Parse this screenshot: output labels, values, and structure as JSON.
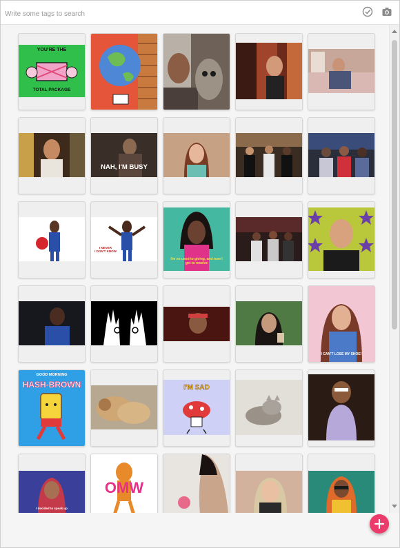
{
  "search": {
    "placeholder": "Write some tags to search",
    "value": ""
  },
  "toolbar": {
    "select_icon": "check-circle-icon",
    "capture_icon": "camera-icon"
  },
  "fab": {
    "icon": "plus-icon",
    "color": "#ec3b6b"
  },
  "gifs": {
    "r1": [
      {
        "text_top": "YOU'RE THE",
        "text_bottom": "TOTAL PACKAGE"
      },
      {
        "text": ""
      },
      {
        "text": ""
      },
      {
        "text": ""
      },
      {
        "text": ""
      }
    ],
    "r2": [
      {
        "text": ""
      },
      {
        "text": "NAH, I'M BUSY"
      },
      {
        "text": ""
      },
      {
        "text": ""
      },
      {
        "text": ""
      }
    ],
    "r3": [
      {
        "text": ""
      },
      {
        "text": "I NEVER\nI DON'T KNOW"
      },
      {
        "text": "I'm so used to giving, and now I get to receive"
      },
      {
        "text": ""
      },
      {
        "text": ""
      }
    ],
    "r4": [
      {
        "text": ""
      },
      {
        "text": ""
      },
      {
        "text": ""
      },
      {
        "text": ""
      },
      {
        "text": "I CAN'T LOSE MY SHOE!"
      }
    ],
    "r5": [
      {
        "text_top": "GOOD MORNING",
        "text_main": "HASH-BROWN"
      },
      {
        "text": ""
      },
      {
        "text": "I'M SAD"
      },
      {
        "text": ""
      },
      {
        "text": ""
      }
    ],
    "r6": [
      {
        "text": "I decided to speak up"
      },
      {
        "text": "OMW"
      },
      {
        "text": ""
      },
      {
        "text": ""
      },
      {
        "text": ""
      }
    ]
  }
}
